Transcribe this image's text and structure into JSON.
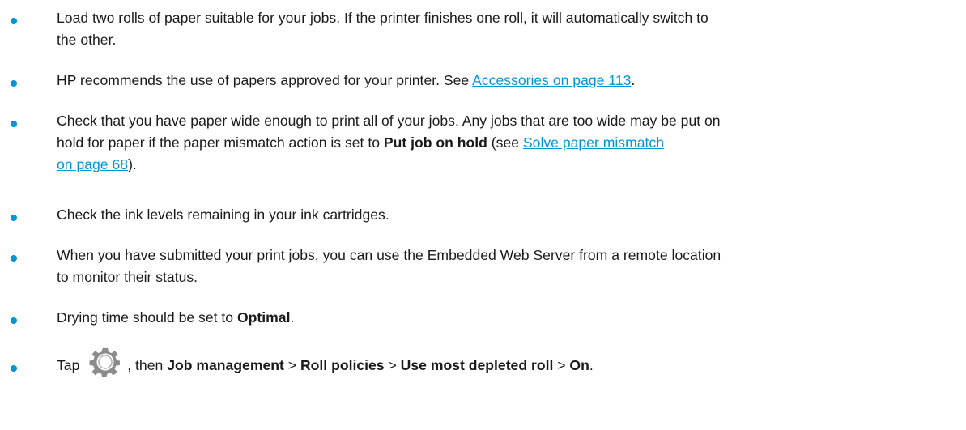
{
  "colors": {
    "bullet": "#0096d6",
    "link": "#0096d6",
    "text": "#1a1a1a",
    "gear_icon": "#8c8c8c"
  },
  "items": [
    {
      "line1": "Load two rolls of paper suitable for your jobs. If the printer finishes one roll, it will automatically switch to",
      "line2": "the other."
    },
    {
      "pre": "HP recommends the use of papers approved for your printer. See ",
      "link": "Accessories on page 113",
      "post": "."
    },
    {
      "line1": "Check that you have paper wide enough to print all of your jobs. Any jobs that are too wide may be put on",
      "line2_pre": "hold for paper if the paper mismatch action is set to ",
      "line2_bold": "Put job on hold",
      "line2_mid": " (see ",
      "line2_link": "Solve paper mismatch",
      "line3_link": "on page 68",
      "line3_post": ")."
    },
    {
      "text": "Check the ink levels remaining in your ink cartridges."
    },
    {
      "line1": "When you have submitted your print jobs, you can use the Embedded Web Server from a remote location",
      "line2": "to monitor their status."
    },
    {
      "pre": "Drying time should be set to ",
      "bold": "Optimal",
      "post": "."
    },
    {
      "pre": "Tap ",
      "icon": "settings-gear-icon",
      "mid": ", then ",
      "b1": "Job management",
      "sep1": " > ",
      "b2": "Roll policies",
      "sep2": " > ",
      "b3": "Use most depleted roll",
      "sep3": " > ",
      "b4": "On",
      "post": "."
    }
  ]
}
